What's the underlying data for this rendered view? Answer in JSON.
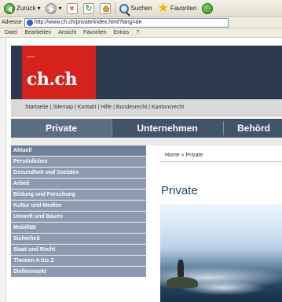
{
  "browser": {
    "toolbar": {
      "back_label": "Zurück",
      "search_label": "Suchen",
      "favorites_label": "Favoriten"
    },
    "address": {
      "label": "Adresse",
      "url": "http://www.ch.ch/private/index.html?lang=de"
    },
    "menu": [
      "Datei",
      "Bearbeiten",
      "Ansicht",
      "Favoriten",
      "Extras",
      "?"
    ]
  },
  "site": {
    "logo": {
      "small_text": "www",
      "text": "ch.ch"
    },
    "service_links": [
      "Startseite",
      "Sitemap",
      "Kontakt",
      "Hilfe",
      "Bundesrecht",
      "Kantonsrecht"
    ],
    "nav": {
      "private": "Private",
      "unternehmen": "Unternehmen",
      "behoerden": "Behörd"
    },
    "sidebar": [
      "Aktuell",
      "Persönliches",
      "Gesundheit und Soziales",
      "Arbeit",
      "Bildung und Forschung",
      "Kultur und Medien",
      "Umwelt und Bauen",
      "Mobilität",
      "Sicherheit",
      "Staat und Recht",
      "Themen A bis Z",
      "Stellenmarkt"
    ],
    "breadcrumb": "Home » Private",
    "content_title": "Private"
  }
}
